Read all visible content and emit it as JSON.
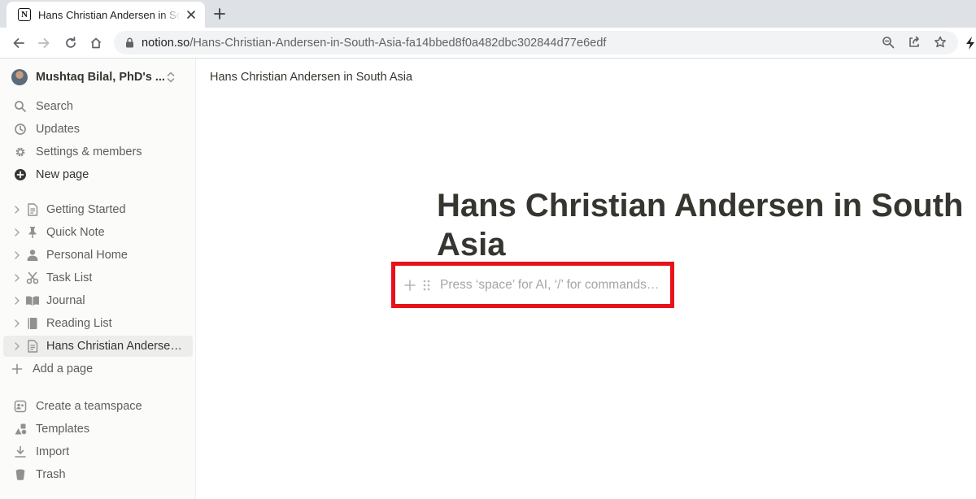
{
  "browser": {
    "tab_title": "Hans Christian Andersen in South Asia",
    "url_host": "notion.so",
    "url_path": "/Hans-Christian-Andersen-in-South-Asia-fa14bbed8f0a482dbc302844d77e6edf"
  },
  "sidebar": {
    "workspace_name": "Mushtaq Bilal, PhD's ...",
    "actions": [
      {
        "label": "Search",
        "icon": "search-icon"
      },
      {
        "label": "Updates",
        "icon": "clock-icon"
      },
      {
        "label": "Settings & members",
        "icon": "gear-icon"
      },
      {
        "label": "New page",
        "icon": "plus-circle-icon"
      }
    ],
    "pages": [
      {
        "label": "Getting Started",
        "icon": "document-icon"
      },
      {
        "label": "Quick Note",
        "icon": "pin-icon"
      },
      {
        "label": "Personal Home",
        "icon": "person-icon"
      },
      {
        "label": "Task List",
        "icon": "scissors-icon"
      },
      {
        "label": "Journal",
        "icon": "open-book-icon"
      },
      {
        "label": "Reading List",
        "icon": "book-icon"
      },
      {
        "label": "Hans Christian Andersen in South Asia",
        "icon": "document-icon"
      }
    ],
    "add_page": "Add a page",
    "footer": [
      {
        "label": "Create a teamspace",
        "icon": "teamspace-icon"
      },
      {
        "label": "Templates",
        "icon": "templates-icon"
      },
      {
        "label": "Import",
        "icon": "import-icon"
      },
      {
        "label": "Trash",
        "icon": "trash-icon"
      }
    ]
  },
  "page": {
    "breadcrumb": "Hans Christian Andersen in South Asia",
    "title": "Hans Christian Andersen in South Asia",
    "block_placeholder": "Press ‘space’ for AI, ‘/’ for commands…"
  },
  "colors": {
    "highlight_box": "#e8121a",
    "sidebar_bg": "#fbfbfa",
    "text": "#37352f"
  }
}
